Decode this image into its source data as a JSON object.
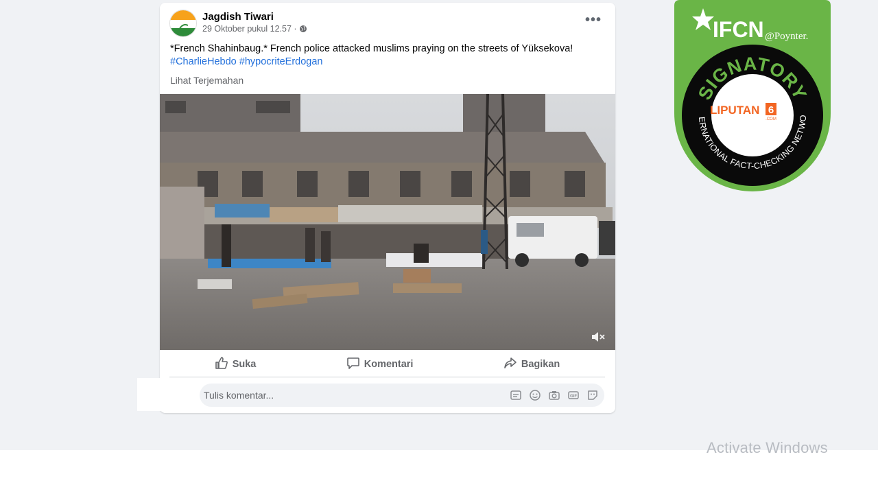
{
  "post": {
    "author": "Jagdish Tiwari",
    "timestamp": "29 Oktober pukul 12.57 ·",
    "more_icon": "more-icon",
    "text": "*French Shahinbaug.* French police attacked muslims praying on the streets of Yüksekova!",
    "hashtags": "#CharlieHebdo #hypocriteErdogan",
    "see_translation": "Lihat Terjemahan"
  },
  "actions": {
    "like": "Suka",
    "comment": "Komentari",
    "share": "Bagikan"
  },
  "comment_box": {
    "placeholder": "Tulis komentar..."
  },
  "badge": {
    "brand": "IFCN",
    "by": "@Poynter.",
    "signatory": "SIGNATORY",
    "network": "INTERNATIONAL FACT-CHECKING NETWORK",
    "member": "LIPUTAN",
    "member_number": "6",
    "member_domain": ".COM"
  },
  "overlay": {
    "activate_windows": "Activate Windows"
  },
  "colors": {
    "badge_green": "#6ab547",
    "link_blue": "#216fdb",
    "liputan_orange": "#f26522"
  }
}
